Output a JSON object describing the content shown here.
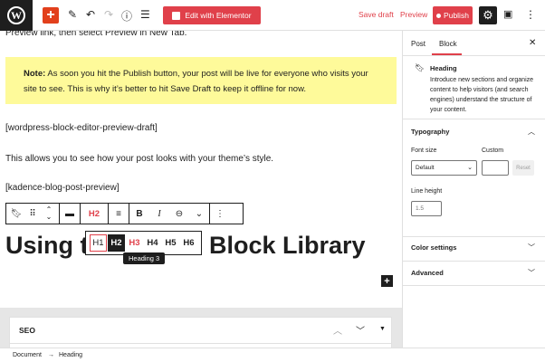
{
  "toolbar": {
    "wp_logo": "W",
    "add_icon": "+",
    "edit_icon": "pencil-icon",
    "undo_icon": "undo-icon",
    "redo_icon": "redo-icon",
    "info_icon": "info-icon",
    "list_view_icon": "list-view-icon",
    "elementor_label": "Edit with Elementor",
    "save_draft_label": "Save draft",
    "preview_label": "Preview",
    "publish_label": "Publish",
    "settings_icon": "gear-icon",
    "accent_color": "#e0404a"
  },
  "editor": {
    "intro_line": "Preview link, then select Preview in New Tab.",
    "note_bold": "Note:",
    "note_text": " As soon you hit the Publish button, your post will be live for everyone who visits your site to see. This is why it’s better to hit Save Draft to keep it offline for now.",
    "shortcode_1": "[wordpress-block-editor-preview-draft]",
    "para_2": "This allows you to see how your post looks with your theme’s style.",
    "shortcode_2": "[kadence-blog-post-preview]",
    "block_toolbar": {
      "level_label": "H2"
    },
    "heading_left": "Using t",
    "heading_right": "Block Library",
    "heading_levels": [
      "H1",
      "H2",
      "H3",
      "H4",
      "H5",
      "H6"
    ],
    "tooltip": "Heading 3",
    "seo_title": "SEO"
  },
  "sidebar": {
    "tabs": [
      "Post",
      "Block"
    ],
    "block_name": "Heading",
    "block_desc": "Introduce new sections and organize content to help visitors (and search engines) understand the structure of your content.",
    "typography_label": "Typography",
    "font_size_label": "Font size",
    "custom_label": "Custom",
    "font_size_value": "Default",
    "reset_label": "Reset",
    "line_height_label": "Line height",
    "line_height_placeholder": "1.5",
    "color_settings_label": "Color settings",
    "advanced_label": "Advanced"
  },
  "statusbar": {
    "crumbs": [
      "Document",
      "Heading"
    ],
    "separator": "→"
  }
}
